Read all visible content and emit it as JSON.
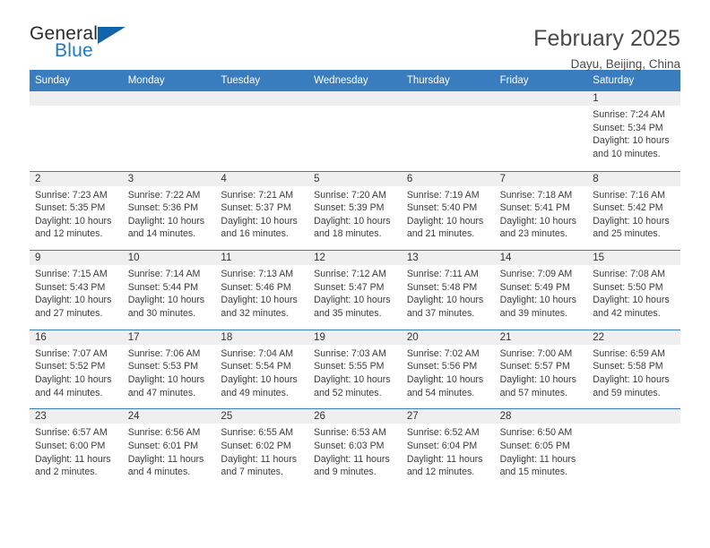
{
  "logo": {
    "general": "General",
    "blue": "Blue",
    "triangle": "triangle-mark"
  },
  "header": {
    "title": "February 2025",
    "subtitle": "Dayu, Beijing, China"
  },
  "colors": {
    "header_blue": "#3a7dbf",
    "logo_blue": "#1f7ac4",
    "day_band_gray": "#efefef"
  },
  "weekdays": [
    "Sunday",
    "Monday",
    "Tuesday",
    "Wednesday",
    "Thursday",
    "Friday",
    "Saturday"
  ],
  "weeks": [
    [
      {
        "day": "",
        "sunrise": "",
        "sunset": "",
        "daylight": "",
        "daylight2": ""
      },
      {
        "day": "",
        "sunrise": "",
        "sunset": "",
        "daylight": "",
        "daylight2": ""
      },
      {
        "day": "",
        "sunrise": "",
        "sunset": "",
        "daylight": "",
        "daylight2": ""
      },
      {
        "day": "",
        "sunrise": "",
        "sunset": "",
        "daylight": "",
        "daylight2": ""
      },
      {
        "day": "",
        "sunrise": "",
        "sunset": "",
        "daylight": "",
        "daylight2": ""
      },
      {
        "day": "",
        "sunrise": "",
        "sunset": "",
        "daylight": "",
        "daylight2": ""
      },
      {
        "day": "1",
        "sunrise": "Sunrise: 7:24 AM",
        "sunset": "Sunset: 5:34 PM",
        "daylight": "Daylight: 10 hours",
        "daylight2": "and 10 minutes."
      }
    ],
    [
      {
        "day": "2",
        "sunrise": "Sunrise: 7:23 AM",
        "sunset": "Sunset: 5:35 PM",
        "daylight": "Daylight: 10 hours",
        "daylight2": "and 12 minutes."
      },
      {
        "day": "3",
        "sunrise": "Sunrise: 7:22 AM",
        "sunset": "Sunset: 5:36 PM",
        "daylight": "Daylight: 10 hours",
        "daylight2": "and 14 minutes."
      },
      {
        "day": "4",
        "sunrise": "Sunrise: 7:21 AM",
        "sunset": "Sunset: 5:37 PM",
        "daylight": "Daylight: 10 hours",
        "daylight2": "and 16 minutes."
      },
      {
        "day": "5",
        "sunrise": "Sunrise: 7:20 AM",
        "sunset": "Sunset: 5:39 PM",
        "daylight": "Daylight: 10 hours",
        "daylight2": "and 18 minutes."
      },
      {
        "day": "6",
        "sunrise": "Sunrise: 7:19 AM",
        "sunset": "Sunset: 5:40 PM",
        "daylight": "Daylight: 10 hours",
        "daylight2": "and 21 minutes."
      },
      {
        "day": "7",
        "sunrise": "Sunrise: 7:18 AM",
        "sunset": "Sunset: 5:41 PM",
        "daylight": "Daylight: 10 hours",
        "daylight2": "and 23 minutes."
      },
      {
        "day": "8",
        "sunrise": "Sunrise: 7:16 AM",
        "sunset": "Sunset: 5:42 PM",
        "daylight": "Daylight: 10 hours",
        "daylight2": "and 25 minutes."
      }
    ],
    [
      {
        "day": "9",
        "sunrise": "Sunrise: 7:15 AM",
        "sunset": "Sunset: 5:43 PM",
        "daylight": "Daylight: 10 hours",
        "daylight2": "and 27 minutes."
      },
      {
        "day": "10",
        "sunrise": "Sunrise: 7:14 AM",
        "sunset": "Sunset: 5:44 PM",
        "daylight": "Daylight: 10 hours",
        "daylight2": "and 30 minutes."
      },
      {
        "day": "11",
        "sunrise": "Sunrise: 7:13 AM",
        "sunset": "Sunset: 5:46 PM",
        "daylight": "Daylight: 10 hours",
        "daylight2": "and 32 minutes."
      },
      {
        "day": "12",
        "sunrise": "Sunrise: 7:12 AM",
        "sunset": "Sunset: 5:47 PM",
        "daylight": "Daylight: 10 hours",
        "daylight2": "and 35 minutes."
      },
      {
        "day": "13",
        "sunrise": "Sunrise: 7:11 AM",
        "sunset": "Sunset: 5:48 PM",
        "daylight": "Daylight: 10 hours",
        "daylight2": "and 37 minutes."
      },
      {
        "day": "14",
        "sunrise": "Sunrise: 7:09 AM",
        "sunset": "Sunset: 5:49 PM",
        "daylight": "Daylight: 10 hours",
        "daylight2": "and 39 minutes."
      },
      {
        "day": "15",
        "sunrise": "Sunrise: 7:08 AM",
        "sunset": "Sunset: 5:50 PM",
        "daylight": "Daylight: 10 hours",
        "daylight2": "and 42 minutes."
      }
    ],
    [
      {
        "day": "16",
        "sunrise": "Sunrise: 7:07 AM",
        "sunset": "Sunset: 5:52 PM",
        "daylight": "Daylight: 10 hours",
        "daylight2": "and 44 minutes."
      },
      {
        "day": "17",
        "sunrise": "Sunrise: 7:06 AM",
        "sunset": "Sunset: 5:53 PM",
        "daylight": "Daylight: 10 hours",
        "daylight2": "and 47 minutes."
      },
      {
        "day": "18",
        "sunrise": "Sunrise: 7:04 AM",
        "sunset": "Sunset: 5:54 PM",
        "daylight": "Daylight: 10 hours",
        "daylight2": "and 49 minutes."
      },
      {
        "day": "19",
        "sunrise": "Sunrise: 7:03 AM",
        "sunset": "Sunset: 5:55 PM",
        "daylight": "Daylight: 10 hours",
        "daylight2": "and 52 minutes."
      },
      {
        "day": "20",
        "sunrise": "Sunrise: 7:02 AM",
        "sunset": "Sunset: 5:56 PM",
        "daylight": "Daylight: 10 hours",
        "daylight2": "and 54 minutes."
      },
      {
        "day": "21",
        "sunrise": "Sunrise: 7:00 AM",
        "sunset": "Sunset: 5:57 PM",
        "daylight": "Daylight: 10 hours",
        "daylight2": "and 57 minutes."
      },
      {
        "day": "22",
        "sunrise": "Sunrise: 6:59 AM",
        "sunset": "Sunset: 5:58 PM",
        "daylight": "Daylight: 10 hours",
        "daylight2": "and 59 minutes."
      }
    ],
    [
      {
        "day": "23",
        "sunrise": "Sunrise: 6:57 AM",
        "sunset": "Sunset: 6:00 PM",
        "daylight": "Daylight: 11 hours",
        "daylight2": "and 2 minutes."
      },
      {
        "day": "24",
        "sunrise": "Sunrise: 6:56 AM",
        "sunset": "Sunset: 6:01 PM",
        "daylight": "Daylight: 11 hours",
        "daylight2": "and 4 minutes."
      },
      {
        "day": "25",
        "sunrise": "Sunrise: 6:55 AM",
        "sunset": "Sunset: 6:02 PM",
        "daylight": "Daylight: 11 hours",
        "daylight2": "and 7 minutes."
      },
      {
        "day": "26",
        "sunrise": "Sunrise: 6:53 AM",
        "sunset": "Sunset: 6:03 PM",
        "daylight": "Daylight: 11 hours",
        "daylight2": "and 9 minutes."
      },
      {
        "day": "27",
        "sunrise": "Sunrise: 6:52 AM",
        "sunset": "Sunset: 6:04 PM",
        "daylight": "Daylight: 11 hours",
        "daylight2": "and 12 minutes."
      },
      {
        "day": "28",
        "sunrise": "Sunrise: 6:50 AM",
        "sunset": "Sunset: 6:05 PM",
        "daylight": "Daylight: 11 hours",
        "daylight2": "and 15 minutes."
      },
      {
        "day": "",
        "sunrise": "",
        "sunset": "",
        "daylight": "",
        "daylight2": ""
      }
    ]
  ]
}
